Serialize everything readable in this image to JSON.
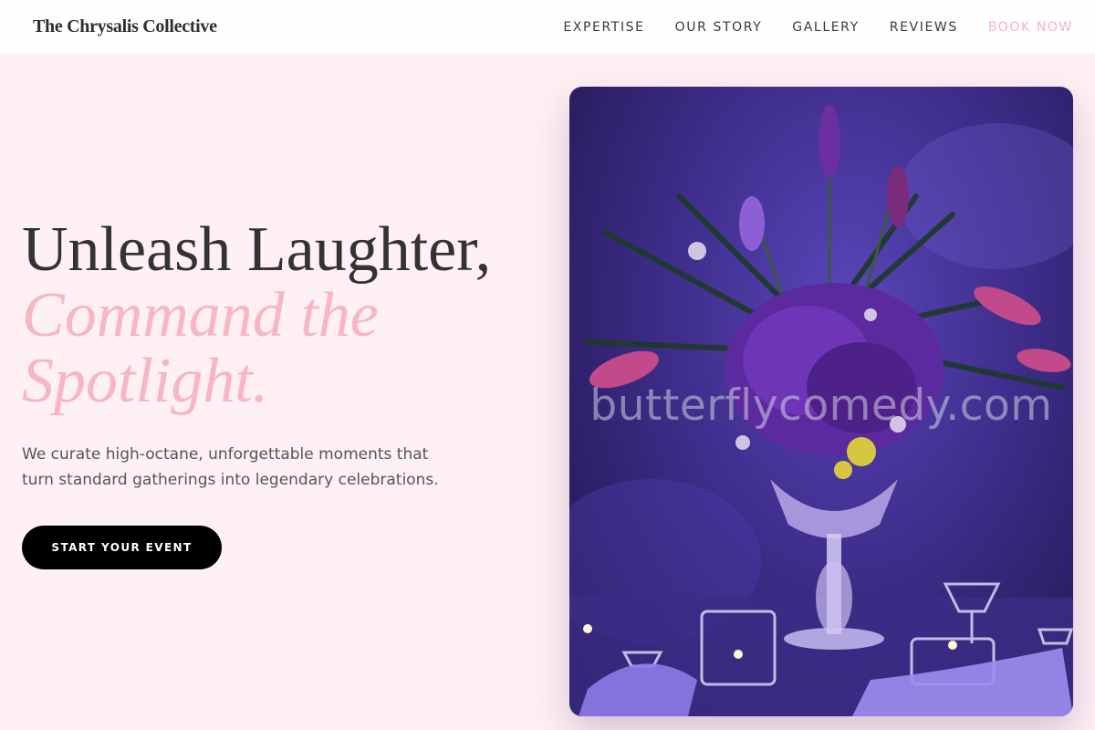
{
  "brand": {
    "name": "The Chrysalis Collective"
  },
  "nav": {
    "items": [
      {
        "label": "EXPERTISE"
      },
      {
        "label": "OUR STORY"
      },
      {
        "label": "GALLERY"
      },
      {
        "label": "REVIEWS"
      },
      {
        "label": "BOOK NOW"
      }
    ],
    "accent_color": "#f4b6c4"
  },
  "hero": {
    "headline_line1": "Unleash Laughter,",
    "headline_accent_line2": "Command the",
    "headline_accent_line3": "Spotlight.",
    "subtext": "We curate high-octane, unforgettable moments that turn standard gatherings into legendary celebrations.",
    "cta_label": "START YOUR EVENT",
    "accent_color": "#f6b6c2"
  },
  "image": {
    "subject": "purple floral centerpiece on a reception table with glassware",
    "watermark": "butterflycomedy.com"
  }
}
